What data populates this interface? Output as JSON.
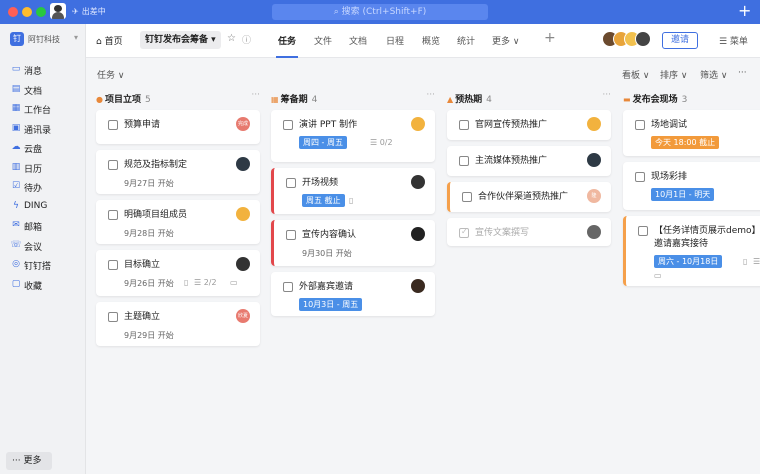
{
  "titlebar": {
    "status": "出差中",
    "search_placeholder": "搜索 (Ctrl+Shift+F)",
    "plus_label": "+"
  },
  "sidebar": {
    "org_logo": "钉",
    "org_name": "阿钉科技",
    "items": [
      {
        "icon": "message-icon",
        "glyph": "▭",
        "label": "消息"
      },
      {
        "icon": "doc-icon",
        "glyph": "▤",
        "label": "文档"
      },
      {
        "icon": "workbench-icon",
        "glyph": "▦",
        "label": "工作台"
      },
      {
        "icon": "contacts-icon",
        "glyph": "▣",
        "label": "通讯录"
      },
      {
        "icon": "cloud-icon",
        "glyph": "☁",
        "label": "云盘"
      },
      {
        "icon": "calendar-icon",
        "glyph": "▥",
        "label": "日历"
      },
      {
        "icon": "todo-icon",
        "glyph": "☑",
        "label": "待办"
      },
      {
        "icon": "ding-icon",
        "glyph": "ϟ",
        "label": "DING"
      },
      {
        "icon": "mail-icon",
        "glyph": "✉",
        "label": "邮箱"
      },
      {
        "icon": "meeting-icon",
        "glyph": "☏",
        "label": "会议"
      },
      {
        "icon": "dingtalk-icon",
        "glyph": "◎",
        "label": "钉钉搭"
      },
      {
        "icon": "favorite-icon",
        "glyph": "▢",
        "label": "收藏"
      }
    ],
    "more_label": "··· 更多"
  },
  "topbar": {
    "home_label": "⌂ 首页",
    "project_label": "钉钉发布会筹备 ▾",
    "tabs": [
      "任务",
      "文件",
      "文档",
      "日程",
      "概览",
      "统计",
      "更多 ∨"
    ],
    "invite_label": "邀请",
    "menu_label": "☰ 菜单"
  },
  "viewbar": {
    "task_filter": "任务 ∨",
    "board": "看板 ∨",
    "sort": "排序 ∨",
    "filter": "筛选 ∨",
    "more": "···"
  },
  "colors": {
    "accent": "#3f6fe0",
    "tag_blue": "#4a8fe7",
    "tag_orange": "#f29a3b",
    "red_bar": "#e2474b",
    "orange_bar": "#f5a04b"
  },
  "columns": [
    {
      "title": "项目立项",
      "count": "5",
      "icon": "bulb-icon",
      "glyph": "●",
      "cards": [
        {
          "title": "预算申请",
          "avatar": "完成"
        },
        {
          "title": "规范及指标制定",
          "date": "9月27日 开始"
        },
        {
          "title": "明确项目组成员",
          "date": "9月28日 开始"
        },
        {
          "title": "目标确立",
          "date": "9月26日 开始",
          "sub": "2/2"
        },
        {
          "title": "主题确立",
          "date": "9月29日 开始",
          "avatar": "欣夏"
        }
      ]
    },
    {
      "title": "筹备期",
      "count": "4",
      "icon": "calendar-icon",
      "glyph": "▦",
      "cards": [
        {
          "title": "演讲 PPT 制作",
          "tag": "周四 - 周五",
          "sub": "0/2"
        },
        {
          "title": "开场视频",
          "tag": "周五 截止"
        },
        {
          "title": "宣传内容确认",
          "date": "9月30日 开始"
        },
        {
          "title": "外部嘉宾邀请",
          "tag": "10月3日 - 周五"
        }
      ]
    },
    {
      "title": "预热期",
      "count": "4",
      "icon": "tree-icon",
      "glyph": "▲",
      "cards": [
        {
          "title": "官网宣传预热推广"
        },
        {
          "title": "主流媒体预热推广"
        },
        {
          "title": "合作伙伴渠道预热推广",
          "avatar": "隆"
        },
        {
          "title": "宣传文案撰写"
        }
      ]
    },
    {
      "title": "发布会现场",
      "count": "3",
      "icon": "car-icon",
      "glyph": "▬",
      "cards": [
        {
          "title": "场地调试",
          "tag": "今天 18:00 截止"
        },
        {
          "title": "现场彩排",
          "tag": "10月1日 - 明天"
        },
        {
          "title": "【任务详情页展示demo】邀请嘉宾接待",
          "tag": "周六 - 10月18日",
          "sub": "0/6"
        }
      ]
    }
  ]
}
